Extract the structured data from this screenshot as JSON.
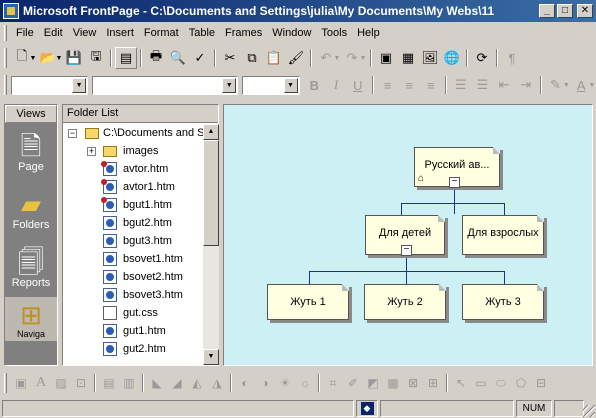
{
  "window": {
    "title": "Microsoft FrontPage - C:\\Documents and Settings\\julia\\My Documents\\My Webs\\11",
    "controls": {
      "minimize": "_",
      "maximize": "□",
      "close": "✕"
    }
  },
  "menubar": {
    "items": [
      "File",
      "Edit",
      "View",
      "Insert",
      "Format",
      "Table",
      "Frames",
      "Window",
      "Tools",
      "Help"
    ]
  },
  "standard_toolbar": {
    "icons": [
      "new-page-icon",
      "open-icon",
      "save-icon",
      "publish-icon",
      "folder-list-icon",
      "print-icon",
      "print-preview-icon",
      "spelling-icon",
      "cut-icon",
      "copy-icon",
      "paste-icon",
      "format-painter-icon",
      "undo-icon",
      "redo-icon",
      "insert-component-icon",
      "insert-table-icon",
      "insert-picture-icon",
      "hyperlink-icon",
      "refresh-icon",
      "show-all-icon"
    ]
  },
  "formatting_toolbar": {
    "style_value": "",
    "font_value": "",
    "size_value": "",
    "bold": "B",
    "italic": "I",
    "underline": "U",
    "highlight_color": "#ffff00",
    "font_color": "#ff0000"
  },
  "views_bar": {
    "header": "Views",
    "items": [
      {
        "label": "Page",
        "icon": "page-view-icon"
      },
      {
        "label": "Folders",
        "icon": "folders-view-icon"
      },
      {
        "label": "Reports",
        "icon": "reports-view-icon"
      },
      {
        "label": "Naviga",
        "icon": "navigation-view-icon",
        "active": true
      }
    ]
  },
  "folder_list": {
    "header": "Folder List",
    "root": "C:\\Documents and S",
    "items": [
      {
        "name": "images",
        "type": "folder"
      },
      {
        "name": "avtor.htm",
        "type": "htm-broken"
      },
      {
        "name": "avtor1.htm",
        "type": "htm-broken"
      },
      {
        "name": "bgut1.htm",
        "type": "htm-broken"
      },
      {
        "name": "bgut2.htm",
        "type": "htm"
      },
      {
        "name": "bgut3.htm",
        "type": "htm"
      },
      {
        "name": "bsovet1.htm",
        "type": "htm"
      },
      {
        "name": "bsovet2.htm",
        "type": "htm"
      },
      {
        "name": "bsovet3.htm",
        "type": "htm"
      },
      {
        "name": "gut.css",
        "type": "css"
      },
      {
        "name": "gut1.htm",
        "type": "htm"
      },
      {
        "name": "gut2.htm",
        "type": "htm"
      }
    ]
  },
  "navigation": {
    "home": {
      "title": "Русский ав...",
      "collapse": "−"
    },
    "level1": [
      {
        "title": "Для детей",
        "collapse": "−"
      },
      {
        "title": "Для взрослых"
      }
    ],
    "level2": [
      {
        "title": "Жуть 1"
      },
      {
        "title": "Жуть 2"
      },
      {
        "title": "Жуть 3"
      }
    ],
    "background": "#cdf0f4",
    "box_color": "#ffffe1",
    "line_color": "#1a2e9a"
  },
  "drawing_toolbar": {
    "icons": [
      "select-icon",
      "text-icon",
      "align-icon",
      "bring-forward-icon",
      "send-backward-icon",
      "rotate-left-icon",
      "rotate-right-icon",
      "flip-horizontal-icon",
      "flip-vertical-icon",
      "more-contrast-icon",
      "less-contrast-icon",
      "more-brightness-icon",
      "less-brightness-icon",
      "crop-icon",
      "line-style-icon",
      "set-transparent-icon",
      "black-white-icon",
      "bevel-icon",
      "resample-icon",
      "select-arrow-icon",
      "rectangle-icon",
      "oval-icon",
      "polygon-icon",
      "hotspot-icon"
    ]
  },
  "statusbar": {
    "indicator": "NUM"
  }
}
